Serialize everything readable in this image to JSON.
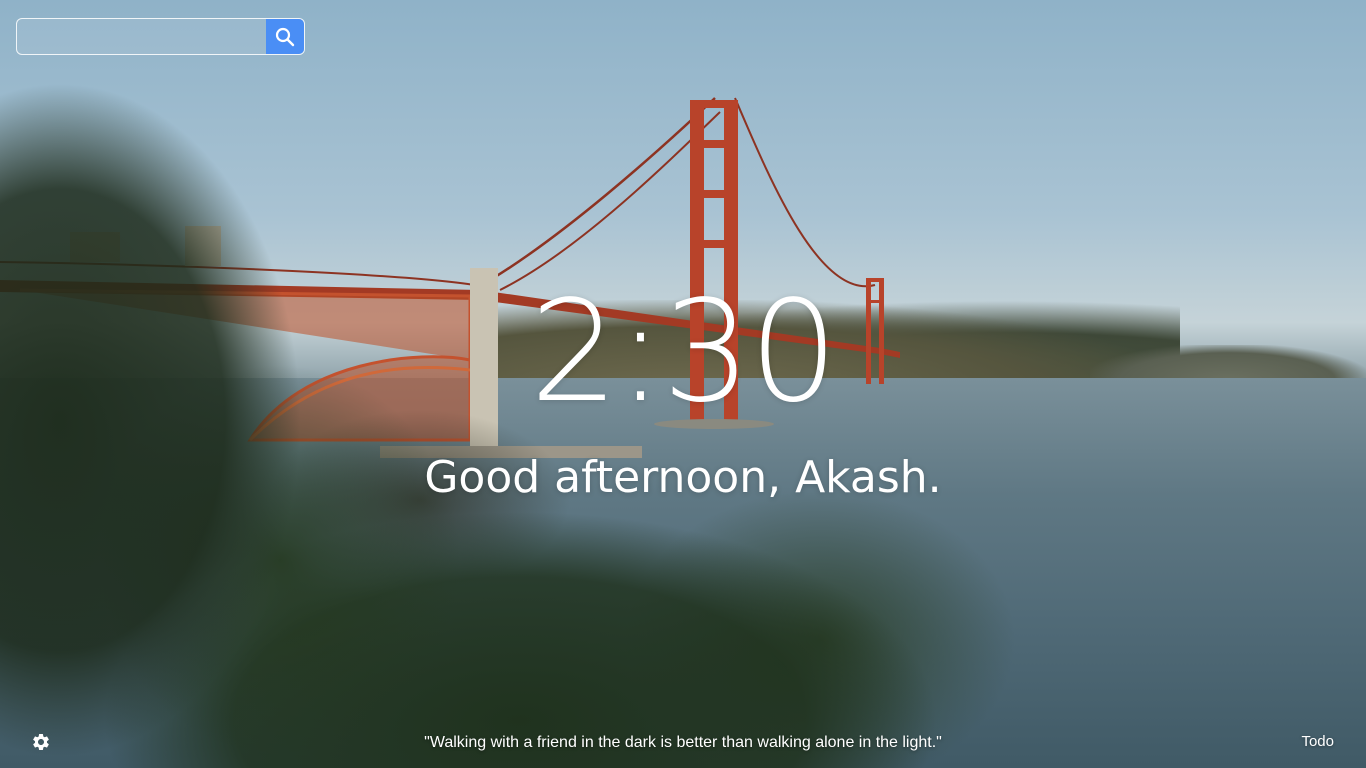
{
  "search": {
    "value": "",
    "placeholder": "",
    "button_icon": "search-icon",
    "button_color": "#4a8ef5"
  },
  "clock": {
    "time": "2:30"
  },
  "greeting": {
    "text": "Good afternoon, Akash."
  },
  "footer": {
    "settings_icon": "gear-icon",
    "quote": "\"Walking with a friend in the dark is better than walking alone in the light.\"",
    "todo_label": "Todo"
  },
  "background": {
    "scene": "golden-gate-bridge-photo",
    "bridge_color": "#b8432a"
  }
}
